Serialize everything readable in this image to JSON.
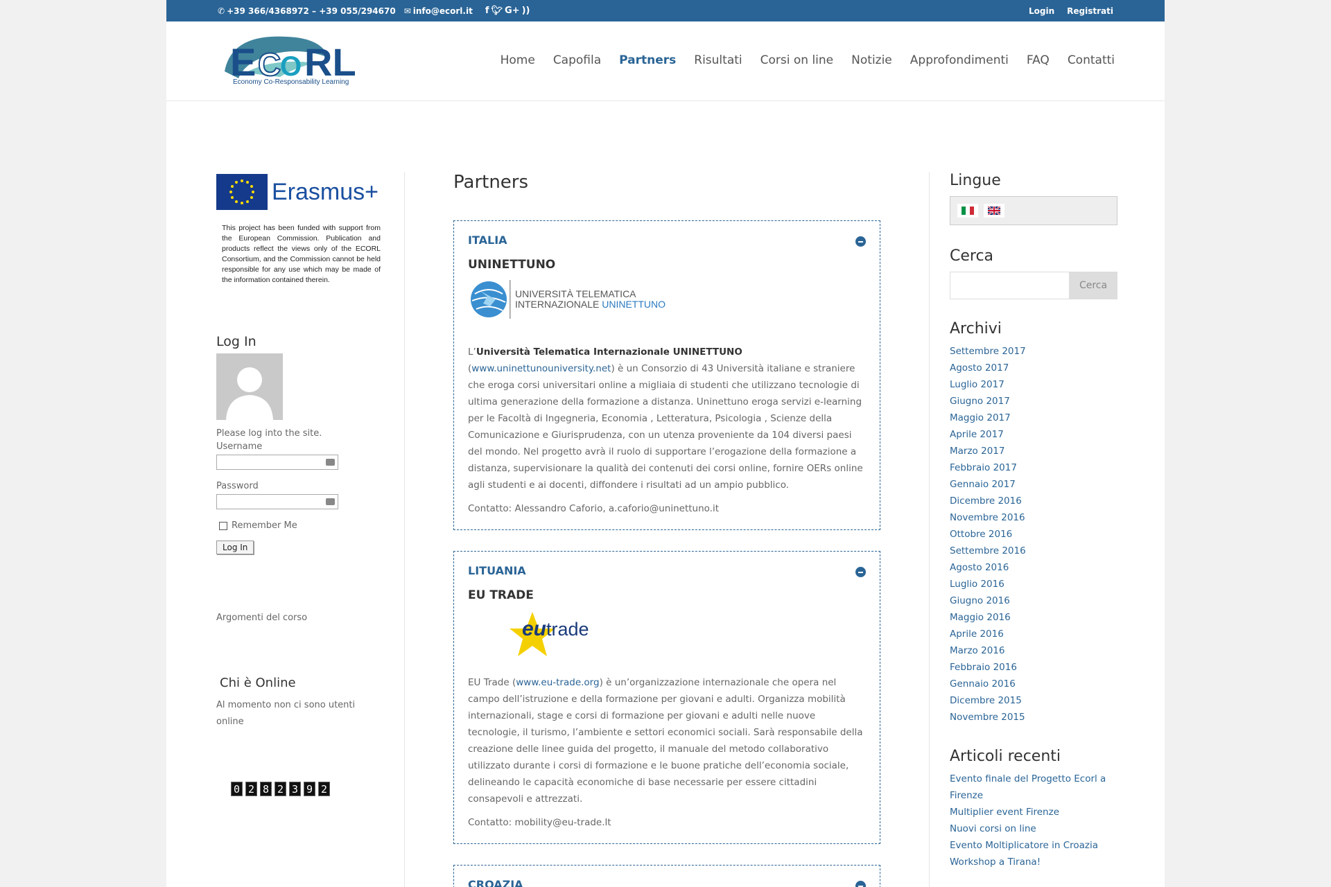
{
  "topbar": {
    "phone": "+39 366/4368972 – +39 055/294670",
    "email": "info@ecorl.it",
    "login": "Login",
    "register": "Registrati"
  },
  "logo": {
    "wordmark": "ECORL",
    "tagline": "Economy Co-Responsability Learning"
  },
  "nav": [
    "Home",
    "Capofila",
    "Partners",
    "Risultati",
    "Corsi on line",
    "Notizie",
    "Approfondimenti",
    "FAQ",
    "Contatti"
  ],
  "left": {
    "erasmus": "Erasmus+",
    "disclaimer": "This project has been funded with support from the European Commission. Publication and products reflect the views only of the ECORL Consortium, and the Commission cannot be held responsible for any use which may be made of the information contained therein.",
    "login_title": "Log In",
    "login_prompt": "Please log into the site.",
    "username_label": "Username",
    "password_label": "Password",
    "remember": "Remember Me",
    "login_button": "Log In",
    "topics": "Argomenti del corso",
    "online_title": "Chi è Online",
    "online_text": "Al momento non ci sono utenti online",
    "counter": [
      "0",
      "2",
      "8",
      "2",
      "3",
      "9",
      "2"
    ]
  },
  "main": {
    "title": "Partners",
    "partners": [
      {
        "country": "ITALIA",
        "org": "UNINETTUNO",
        "logo_line1": "UNIVERSITÀ TELEMATICA",
        "logo_line2a": "INTERNAZIONALE",
        "logo_line2b": "UNINETTUNO",
        "desc_pre": "L’",
        "desc_bold": "Università Telematica Internazionale UNINETTUNO",
        "desc_paren_open": "(",
        "desc_link": "www.uninettunouniversity.net",
        "desc_rest": ") è un Consorzio di 43 Università italiane e straniere che eroga corsi universitari online a migliaia di studenti che utilizzano tecnologie di ultima generazione della formazione a distanza. Uninettuno eroga servizi e-learning per le Facoltà di Ingegneria, Economia , Letteratura, Psicologia , Scienze della Comunicazione e Giurisprudenza, con un utenza proveniente da 104 diversi paesi del mondo. Nel progetto avrà il ruolo di supportare l’erogazione della formazione a distanza, supervisionare la qualità dei contenuti dei corsi online, fornire OERs online agli studenti e ai docenti, diffondere i risultati ad un ampio pubblico.",
        "contact": "Contatto: Alessandro Caforio, a.caforio@uninettuno.it"
      },
      {
        "country": "LITUANIA",
        "org": "EU TRADE",
        "logo_a": "eu",
        "logo_b": "trade",
        "desc_pre": "EU Trade (",
        "desc_link": "www.eu-trade.org",
        "desc_rest": ") è un’organizzazione internazionale che opera nel campo dell’istruzione e della formazione per giovani e adulti. Organizza  mobilità internazionali, stage e corsi di formazione per giovani e adulti nelle nuove tecnologie, il turismo, l’ambiente e settori economici sociali. Sarà responsabile della creazione delle linee guida del progetto, il manuale del metodo collaborativo utilizzato durante i corsi di formazione e le buone pratiche dell’economia sociale, delineando le capacità economiche di base necessarie per essere cittadini consapevoli e attrezzati.",
        "contact": "Contatto: mobility@eu-trade.lt"
      },
      {
        "country": "CROAZIA"
      }
    ]
  },
  "right": {
    "lang_title": "Lingue",
    "search_title": "Cerca",
    "search_button": "Cerca",
    "archive_title": "Archivi",
    "archives": [
      "Settembre 2017",
      "Agosto 2017",
      "Luglio 2017",
      "Giugno 2017",
      "Maggio 2017",
      "Aprile 2017",
      "Marzo 2017",
      "Febbraio 2017",
      "Gennaio 2017",
      "Dicembre 2016",
      "Novembre 2016",
      "Ottobre 2016",
      "Settembre 2016",
      "Agosto 2016",
      "Luglio 2016",
      "Giugno 2016",
      "Maggio 2016",
      "Aprile 2016",
      "Marzo 2016",
      "Febbraio 2016",
      "Gennaio 2016",
      "Dicembre 2015",
      "Novembre 2015"
    ],
    "recent_title": "Articoli recenti",
    "recent": [
      "Evento finale del Progetto Ecorl a Firenze",
      "Multiplier event Firenze",
      "Nuovi corsi on line",
      "Evento Moltiplicatore in Croazia",
      "Workshop a Tirana!"
    ]
  },
  "colors": {
    "brand": "#2a6496",
    "text": "#666666",
    "heading": "#333333"
  }
}
